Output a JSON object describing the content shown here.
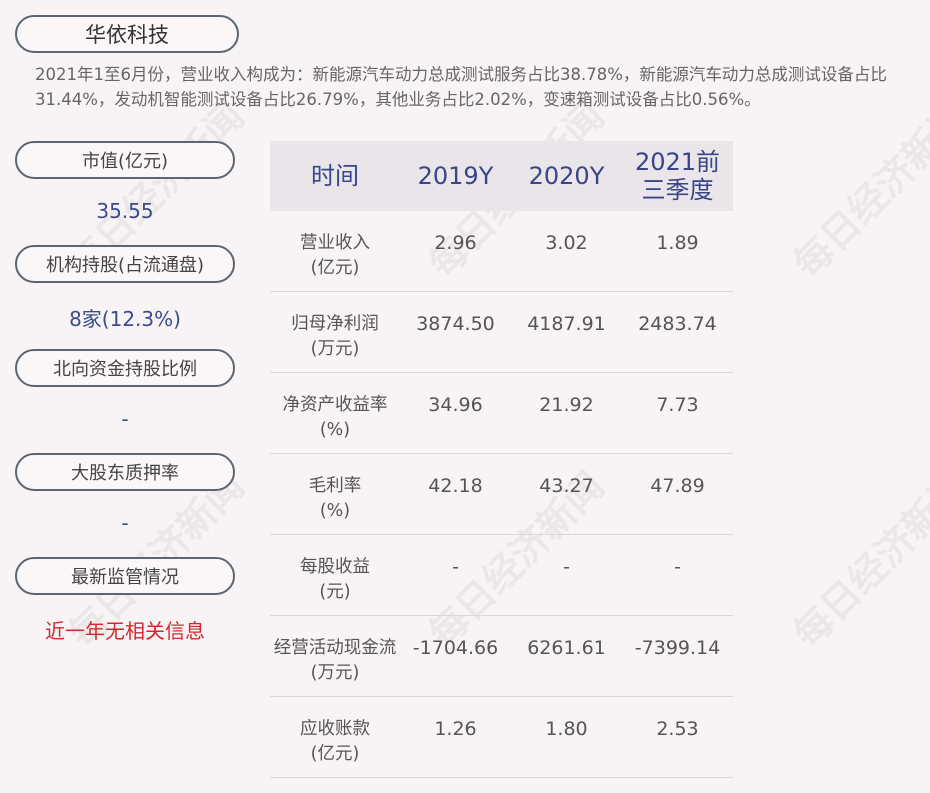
{
  "company_name": "华依科技",
  "summary": "2021年1至6月份，营业收入构成为：新能源汽车动力总成测试服务占比38.78%，新能源汽车动力总成测试设备占比31.44%，发动机智能测试设备占比26.79%，其他业务占比2.02%，变速箱测试设备占比0.56%。",
  "left_panel": [
    {
      "label": "市值(亿元)",
      "value": "35.55"
    },
    {
      "label": "机构持股(占流通盘)",
      "value": "8家(12.3%)"
    },
    {
      "label": "北向资金持股比例",
      "value": "-"
    },
    {
      "label": "大股东质押率",
      "value": "-"
    },
    {
      "label": "最新监管情况",
      "value": "近一年无相关信息"
    }
  ],
  "table": {
    "headers": [
      "时间",
      "2019Y",
      "2020Y",
      "2021前三季度"
    ],
    "rows": [
      {
        "label": "营业收入\n(亿元)",
        "values": [
          "2.96",
          "3.02",
          "1.89"
        ]
      },
      {
        "label": "归母净利润\n(万元)",
        "values": [
          "3874.50",
          "4187.91",
          "2483.74"
        ]
      },
      {
        "label": "净资产收益率\n(%)",
        "values": [
          "34.96",
          "21.92",
          "7.73"
        ]
      },
      {
        "label": "毛利率\n(%)",
        "values": [
          "42.18",
          "43.27",
          "47.89"
        ]
      },
      {
        "label": "每股收益\n(元)",
        "values": [
          "-",
          "-",
          "-"
        ]
      },
      {
        "label": "经营活动现金流\n(万元)",
        "values": [
          "-1704.66",
          "6261.61",
          "-7399.14"
        ]
      },
      {
        "label": "应收账款\n(亿元)",
        "values": [
          "1.26",
          "1.80",
          "2.53"
        ]
      }
    ]
  },
  "watermark": "每日经济新闻",
  "colors": {
    "value_blue": "#3a4c8a",
    "alert_red": "#d3282f",
    "header_bg": "#e9e5e8"
  }
}
